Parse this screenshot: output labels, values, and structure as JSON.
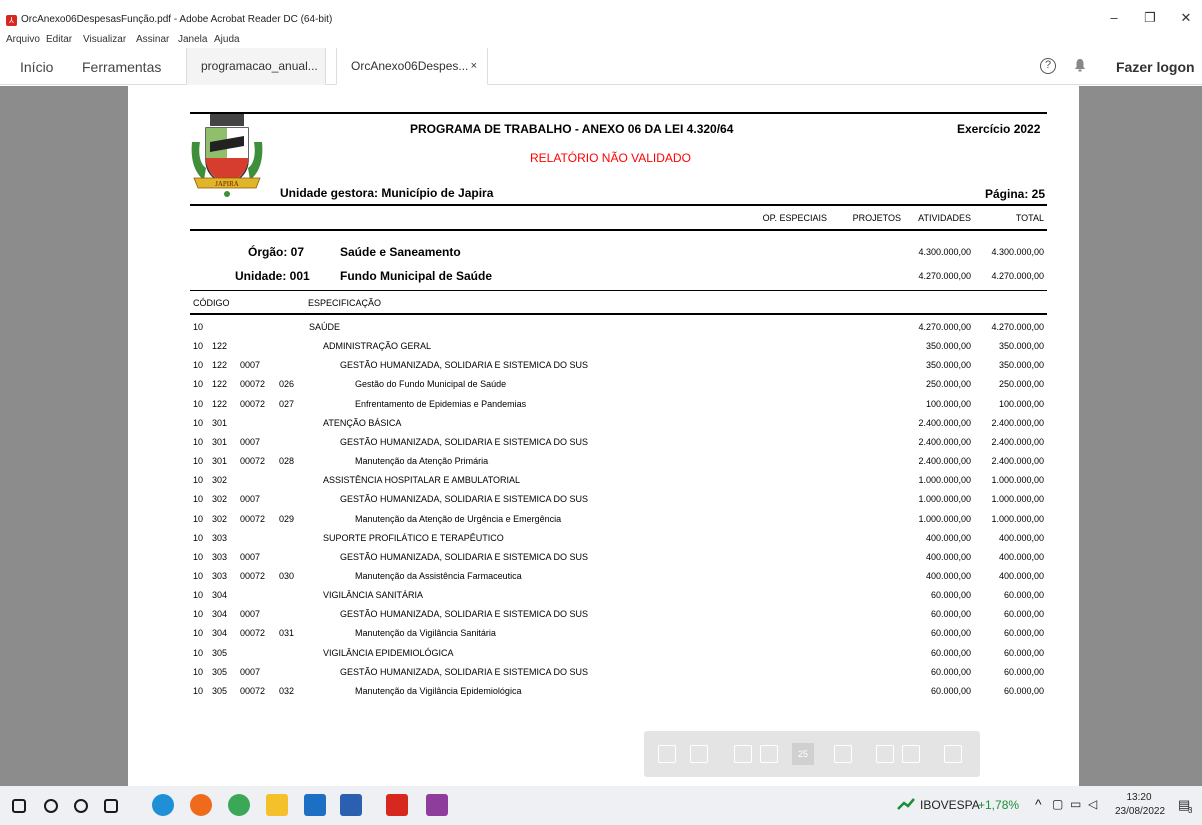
{
  "window": {
    "title": "OrcAnexo06DespesasFunção.pdf - Adobe Acrobat Reader DC (64-bit)",
    "app_icon": "acrobat-icon",
    "controls": {
      "minimize": "–",
      "restore": "❐",
      "close": "✕"
    }
  },
  "menu": [
    "Arquivo",
    "Editar",
    "Visualizar",
    "Assinar",
    "Janela",
    "Ajuda"
  ],
  "tabs": {
    "home": "Início",
    "tools": "Ferramentas",
    "documents": [
      {
        "label": "programacao_anual...",
        "active": false
      },
      {
        "label": "OrcAnexo06Despes...",
        "active": true,
        "close": "×"
      }
    ]
  },
  "toolbar": {
    "help": "?",
    "login": "Fazer logon",
    "bell_icon": "bell-icon"
  },
  "report": {
    "title": "PROGRAMA DE TRABALHO - ANEXO 06 DA LEI 4.320/64",
    "year": "Exercício 2022",
    "status": "RELATÓRIO NÃO VALIDADO",
    "status_color": "#ff0000",
    "unit": "Unidade gestora: Município de Japira",
    "page": "Página: 25",
    "logo_text": "JAPIRA",
    "col_headers": {
      "op": "OP. ESPECIAIS",
      "proj": "PROJETOS",
      "ativ": "ATIVIDADES",
      "total": "TOTAL"
    },
    "orgao": {
      "label": "Órgão: 07",
      "name": "Saúde e Saneamento",
      "ativ": "4.300.000,00",
      "total": "4.300.000,00"
    },
    "unidade": {
      "label": "Unidade: 001",
      "name": "Fundo Municipal de Saúde",
      "ativ": "4.270.000,00",
      "total": "4.270.000,00"
    },
    "table_headers": {
      "code": "CÓDIGO",
      "spec": "ESPECIFICAÇÃO"
    },
    "rows": [
      {
        "c1": "10",
        "c2": "",
        "c3": "",
        "c4": "",
        "spec": "SAÚDE",
        "level": 0,
        "ativ": "4.270.000,00",
        "total": "4.270.000,00"
      },
      {
        "c1": "10",
        "c2": "122",
        "c3": "",
        "c4": "",
        "spec": "ADMINISTRAÇÃO GERAL",
        "level": 1,
        "ativ": "350.000,00",
        "total": "350.000,00"
      },
      {
        "c1": "10",
        "c2": "122",
        "c3": "0007",
        "c4": "",
        "spec": "GESTÃO HUMANIZADA, SOLIDARIA E SISTEMICA DO SUS",
        "level": 2,
        "ativ": "350.000,00",
        "total": "350.000,00"
      },
      {
        "c1": "10",
        "c2": "122",
        "c3": "00072",
        "c4": "026",
        "spec": "Gestão do Fundo Municipal de Saúde",
        "level": 3,
        "ativ": "250.000,00",
        "total": "250.000,00"
      },
      {
        "c1": "10",
        "c2": "122",
        "c3": "00072",
        "c4": "027",
        "spec": "Enfrentamento de Epidemias e Pandemias",
        "level": 3,
        "ativ": "100.000,00",
        "total": "100.000,00"
      },
      {
        "c1": "10",
        "c2": "301",
        "c3": "",
        "c4": "",
        "spec": "ATENÇÃO BÁSICA",
        "level": 1,
        "ativ": "2.400.000,00",
        "total": "2.400.000,00"
      },
      {
        "c1": "10",
        "c2": "301",
        "c3": "0007",
        "c4": "",
        "spec": "GESTÃO HUMANIZADA, SOLIDARIA E SISTEMICA DO SUS",
        "level": 2,
        "ativ": "2.400.000,00",
        "total": "2.400.000,00"
      },
      {
        "c1": "10",
        "c2": "301",
        "c3": "00072",
        "c4": "028",
        "spec": "Manutenção da Atenção Primária",
        "level": 3,
        "ativ": "2.400.000,00",
        "total": "2.400.000,00"
      },
      {
        "c1": "10",
        "c2": "302",
        "c3": "",
        "c4": "",
        "spec": "ASSISTÊNCIA HOSPITALAR E AMBULATORIAL",
        "level": 1,
        "ativ": "1.000.000,00",
        "total": "1.000.000,00"
      },
      {
        "c1": "10",
        "c2": "302",
        "c3": "0007",
        "c4": "",
        "spec": "GESTÃO HUMANIZADA, SOLIDARIA E SISTEMICA DO SUS",
        "level": 2,
        "ativ": "1.000.000,00",
        "total": "1.000.000,00"
      },
      {
        "c1": "10",
        "c2": "302",
        "c3": "00072",
        "c4": "029",
        "spec": "Manutenção da Atenção de Urgência e Emergência",
        "level": 3,
        "ativ": "1.000.000,00",
        "total": "1.000.000,00"
      },
      {
        "c1": "10",
        "c2": "303",
        "c3": "",
        "c4": "",
        "spec": "SUPORTE PROFILÁTICO E TERAPÊUTICO",
        "level": 1,
        "ativ": "400.000,00",
        "total": "400.000,00"
      },
      {
        "c1": "10",
        "c2": "303",
        "c3": "0007",
        "c4": "",
        "spec": "GESTÃO HUMANIZADA, SOLIDARIA E SISTEMICA DO SUS",
        "level": 2,
        "ativ": "400.000,00",
        "total": "400.000,00"
      },
      {
        "c1": "10",
        "c2": "303",
        "c3": "00072",
        "c4": "030",
        "spec": "Manutenção da Assistência Farmaceutica",
        "level": 3,
        "ativ": "400.000,00",
        "total": "400.000,00"
      },
      {
        "c1": "10",
        "c2": "304",
        "c3": "",
        "c4": "",
        "spec": "VIGILÂNCIA SANITÁRIA",
        "level": 1,
        "ativ": "60.000,00",
        "total": "60.000,00"
      },
      {
        "c1": "10",
        "c2": "304",
        "c3": "0007",
        "c4": "",
        "spec": "GESTÃO HUMANIZADA, SOLIDARIA E SISTEMICA DO SUS",
        "level": 2,
        "ativ": "60.000,00",
        "total": "60.000,00"
      },
      {
        "c1": "10",
        "c2": "304",
        "c3": "00072",
        "c4": "031",
        "spec": "Manutenção da Vigilância Sanitária",
        "level": 3,
        "ativ": "60.000,00",
        "total": "60.000,00"
      },
      {
        "c1": "10",
        "c2": "305",
        "c3": "",
        "c4": "",
        "spec": "VIGILÂNCIA EPIDEMIOLÓGICA",
        "level": 1,
        "ativ": "60.000,00",
        "total": "60.000,00"
      },
      {
        "c1": "10",
        "c2": "305",
        "c3": "0007",
        "c4": "",
        "spec": "GESTÃO HUMANIZADA, SOLIDARIA E SISTEMICA DO SUS",
        "level": 2,
        "ativ": "60.000,00",
        "total": "60.000,00"
      },
      {
        "c1": "10",
        "c2": "305",
        "c3": "00072",
        "c4": "032",
        "spec": "Manutenção da Vigilância Epidemiológica",
        "level": 3,
        "ativ": "60.000,00",
        "total": "60.000,00"
      }
    ]
  },
  "floating_toolbar": {
    "page_number": "25"
  },
  "taskbar": {
    "apps": [
      {
        "name": "start-icon",
        "color": "#1a1a1a"
      },
      {
        "name": "search-icon",
        "color": "#1a1a1a"
      },
      {
        "name": "cortana-icon",
        "color": "#1a1a1a"
      },
      {
        "name": "task-view-icon",
        "color": "#1a1a1a"
      },
      {
        "name": "edge-icon",
        "color": "#1f8fd6"
      },
      {
        "name": "firefox-icon",
        "color": "#f06a1c"
      },
      {
        "name": "chrome-icon",
        "color": "#3aa856"
      },
      {
        "name": "file-explorer-icon",
        "color": "#f5c12b"
      },
      {
        "name": "store-icon",
        "color": "#1c6fc2"
      },
      {
        "name": "word-icon",
        "color": "#2b5fb0"
      },
      {
        "name": "acrobat-icon",
        "color": "#d6281f"
      },
      {
        "name": "winrar-icon",
        "color": "#8e3d9c"
      }
    ],
    "stock": {
      "name": "IBOVESPA",
      "change": "+1,78%",
      "color": "#1a8f3a"
    },
    "tray_chevron": "^",
    "time": "13:20",
    "date": "23/08/2022",
    "notifications": "3"
  }
}
